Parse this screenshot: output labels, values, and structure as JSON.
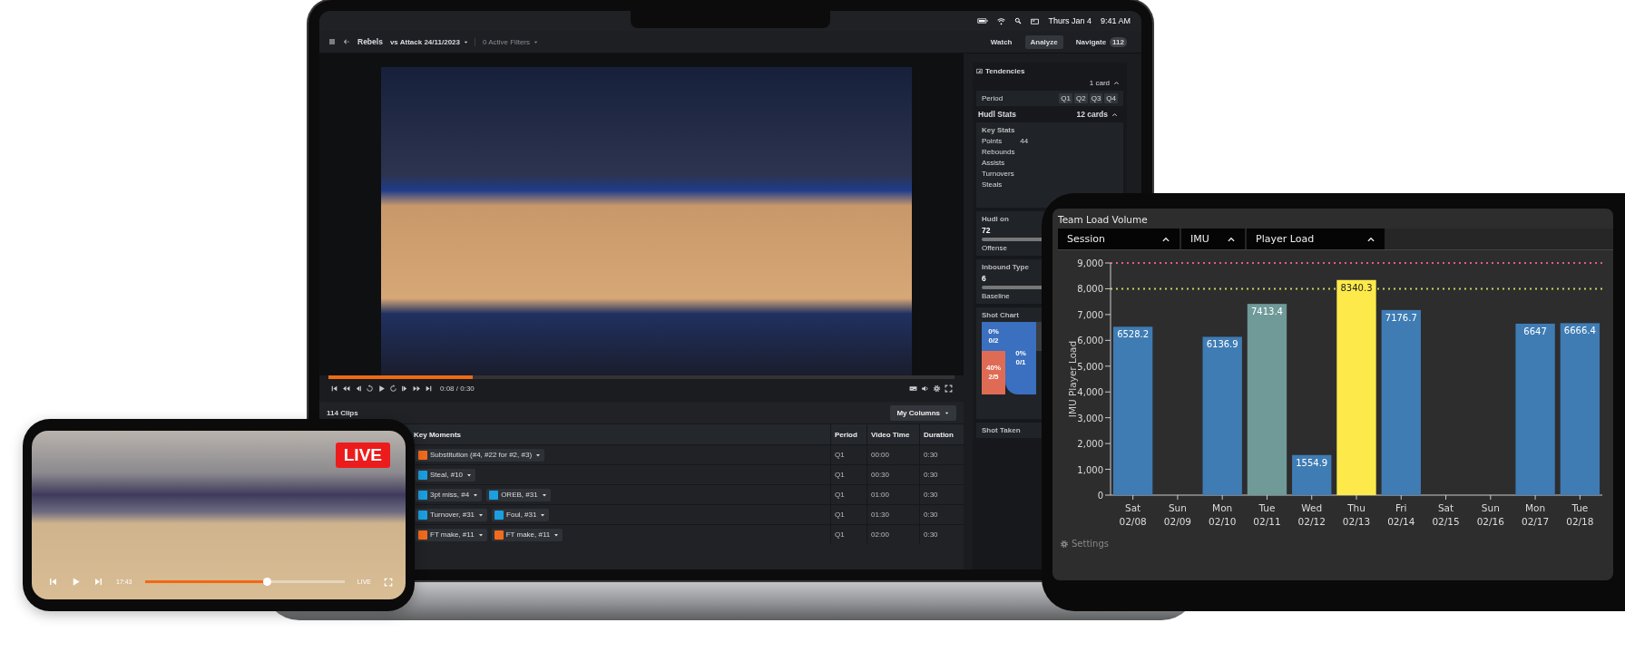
{
  "laptop": {
    "status_bar": {
      "date": "Thurs Jan 4",
      "time": "9:41 AM"
    },
    "toolbar": {
      "title": "Rebels",
      "game": "vs Attack 24/11/2023",
      "filters": {
        "label": "0 Active Filters",
        "disabled": true
      },
      "tabs": [
        {
          "label": "Watch",
          "selected": false
        },
        {
          "label": "Analyze",
          "selected": true
        },
        {
          "label": "Navigate",
          "selected": false,
          "badge": "112"
        }
      ]
    },
    "player": {
      "level": 0.23,
      "time": "0:08 / 0:30"
    },
    "clips": {
      "count": "114 Clips",
      "columns_button": "My Columns",
      "columns": [
        "Key Moments",
        "Period",
        "Video Time",
        "Duration"
      ],
      "rows": [
        {
          "moments": [
            {
              "label": "Substitution (#4, #22 for #2, #3)",
              "color": "#f26b1d"
            }
          ],
          "period": "Q1",
          "video_time": "00:00",
          "duration": "0:30"
        },
        {
          "moments": [
            {
              "label": "Steal, #10",
              "color": "#1b9fe0"
            }
          ],
          "period": "Q1",
          "video_time": "00:30",
          "duration": "0:30"
        },
        {
          "moments": [
            {
              "label": "3pt miss, #4",
              "color": "#1b9fe0"
            },
            {
              "label": "OREB, #31",
              "color": "#1b9fe0"
            }
          ],
          "period": "Q1",
          "video_time": "01:00",
          "duration": "0:30"
        },
        {
          "moments": [
            {
              "label": "Turnover, #31",
              "color": "#1b9fe0"
            },
            {
              "label": "Foul, #31",
              "color": "#1b9fe0"
            }
          ],
          "period": "Q1",
          "video_time": "01:30",
          "duration": "0:30"
        },
        {
          "moments": [
            {
              "label": "FT make, #11",
              "color": "#f26b1d"
            },
            {
              "label": "FT make, #11",
              "color": "#f26b1d"
            }
          ],
          "period": "Q1",
          "video_time": "02:00",
          "duration": "0:30"
        }
      ]
    },
    "sidebar": {
      "title": "Tendencies",
      "cards_count": "1 card",
      "period": {
        "label": "Period",
        "options": [
          "Q1",
          "Q2",
          "Q3",
          "Q4"
        ]
      },
      "stats_title": "Hudl Stats",
      "stats_count": "12 cards",
      "key_stats": {
        "title": "Key Stats",
        "rows": [
          {
            "label": "Points",
            "value": "44"
          },
          {
            "label": "Rebounds"
          },
          {
            "label": "Assists"
          },
          {
            "label": "Turnovers"
          },
          {
            "label": "Steals"
          }
        ]
      },
      "metrics": [
        {
          "title": "Hudl on",
          "value": "72",
          "label": "Offense"
        },
        {
          "title": "Inbound Type",
          "value": "6",
          "label": "Baseline"
        }
      ],
      "shot_chart": {
        "title": "Shot Chart",
        "zones": [
          {
            "pct": "0%",
            "made": "0/2",
            "color": "#3b6fbf"
          },
          {
            "pct": "0%",
            "made": "0/1",
            "color": "#3b6fbf"
          },
          {
            "pct": "40%",
            "made": "2/5",
            "color": "#df6b55"
          }
        ]
      },
      "shot_taken": "Shot Taken"
    }
  },
  "tablet": {
    "title": "Team Load Volume",
    "dropdowns": [
      "Session",
      "IMU",
      "Player Load"
    ],
    "settings": "Settings",
    "chart_data": {
      "type": "bar",
      "ylabel": "IMU Player Load",
      "categories": [
        "Sat 02/08",
        "Sun 02/09",
        "Mon 02/10",
        "Tue 02/11",
        "Wed 02/12",
        "Thu 02/13",
        "Fri 02/14",
        "Sat 02/15",
        "Sun 02/16",
        "Mon 02/17",
        "Tue 02/18"
      ],
      "series": [
        {
          "color": "#3f7cb4",
          "values": [
            6528.2,
            null,
            6136.9,
            null,
            1554.9,
            null,
            7176.7,
            null,
            null,
            6647,
            6666.4
          ]
        },
        {
          "color": "#6f9a98",
          "values": [
            null,
            null,
            null,
            7413.4,
            null,
            null,
            null,
            null,
            null,
            null,
            null
          ]
        },
        {
          "color": "#fdea4a",
          "values": [
            null,
            null,
            null,
            null,
            null,
            8340.3,
            null,
            null,
            null,
            null,
            null
          ]
        }
      ],
      "stacked": true,
      "ylim": [
        0,
        9000
      ],
      "yticks": [
        {
          "value": 0,
          "label": "0"
        },
        {
          "value": 1000,
          "label": "1,000"
        },
        {
          "value": 2000,
          "label": "2,000"
        },
        {
          "value": 3000,
          "label": "3,000"
        },
        {
          "value": 4000,
          "label": "4,000"
        },
        {
          "value": 5000,
          "label": "5,000"
        },
        {
          "value": 6000,
          "label": "6,000"
        },
        {
          "value": 7000,
          "label": "7,000"
        },
        {
          "value": 8000,
          "label": "8,000"
        },
        {
          "value": 9000,
          "label": "9,000"
        }
      ],
      "data_labels": true,
      "ref_lines": [
        {
          "axis": "y",
          "value": 9000,
          "color": "#e0607a"
        },
        {
          "axis": "y",
          "value": 8000,
          "color": "#c9d45a"
        }
      ]
    }
  },
  "phone": {
    "badge": "LIVE",
    "player": {
      "time": "17:43",
      "level": 0.61,
      "live_label": "LIVE"
    }
  }
}
